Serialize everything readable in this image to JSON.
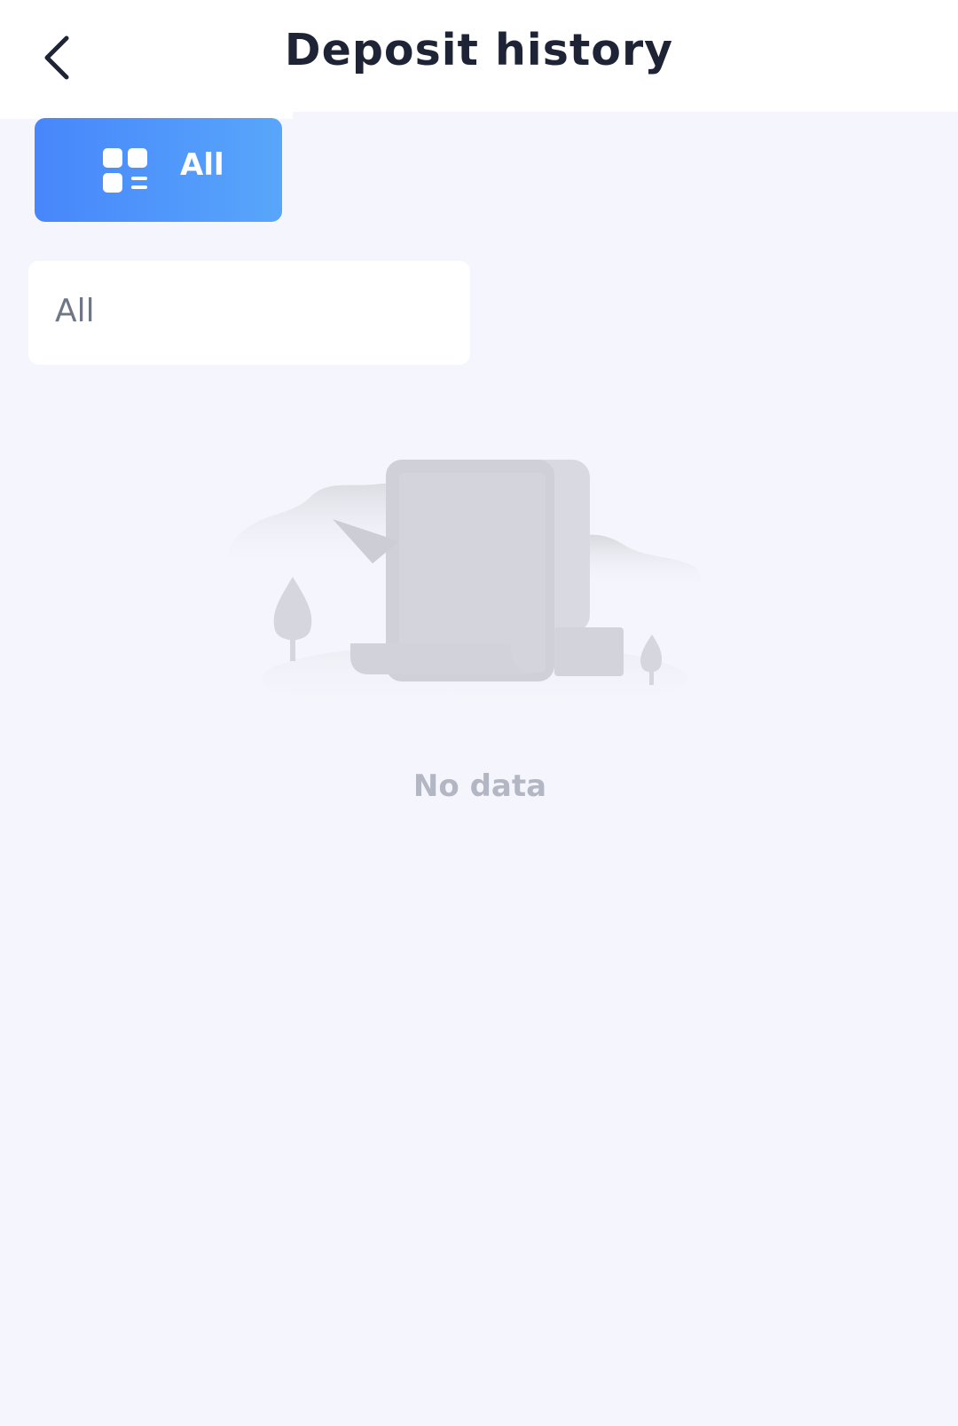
{
  "header": {
    "title": "Deposit history",
    "back_icon": "chevron-left-icon"
  },
  "filter": {
    "category_button_label": "All",
    "category_icon": "grid-list-icon",
    "category_color_start": "#4786fb",
    "category_color_end": "#58a6fb",
    "select_value": "All"
  },
  "empty_state": {
    "illustration": "empty-document-illustration",
    "message": "No data"
  }
}
